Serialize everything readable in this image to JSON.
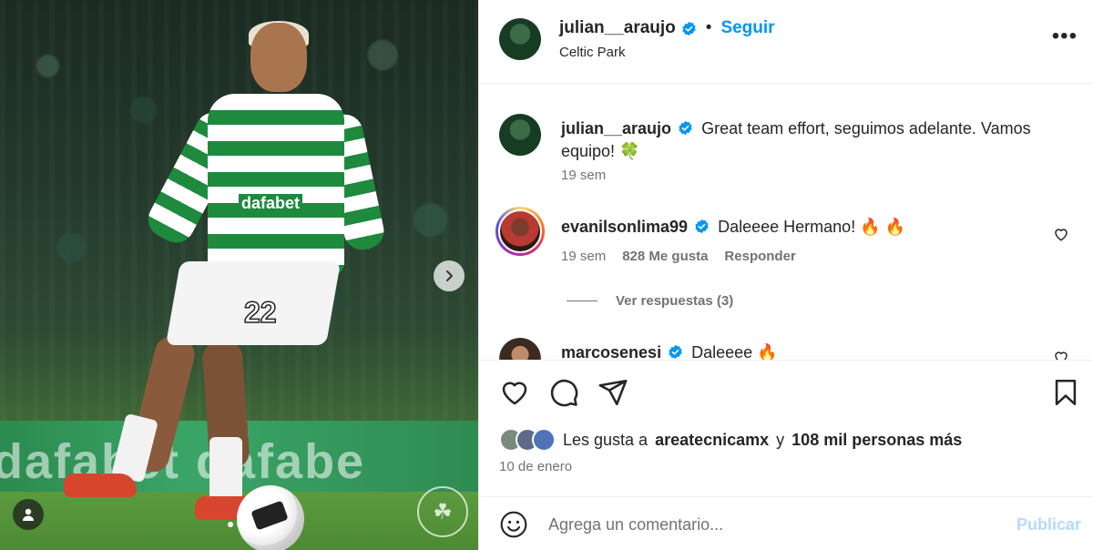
{
  "post": {
    "username": "julian__araujo",
    "follow_label": "Seguir",
    "bullet": "•",
    "location": "Celtic Park",
    "more": "•••"
  },
  "caption": {
    "username": "julian__araujo",
    "text": "Great team effort, seguimos adelante. Vamos equipo! 🍀",
    "time": "19 sem"
  },
  "comments": [
    {
      "username": "evanilsonlima99",
      "text": "Daleeee Hermano! 🔥 🔥",
      "time": "19 sem",
      "likes": "828 Me gusta",
      "reply_label": "Responder",
      "view_replies": "Ver respuestas (3)"
    },
    {
      "username": "marcosenesi",
      "text": "Daleeee 🔥"
    }
  ],
  "likes": {
    "prefix": "Les gusta a",
    "user": "areatecnicamx",
    "connector": "y",
    "others": "108 mil personas más"
  },
  "date": "10 de enero",
  "composer": {
    "placeholder": "Agrega un comentario...",
    "publish_label": "Publicar"
  },
  "photo": {
    "sponsor": "dafabet",
    "shirt_number": "22",
    "adboard": "dafabet dafabe"
  },
  "colors": {
    "follow_blue": "#0095f6",
    "verified_blue": "#0095f6",
    "celtic_green": "#1e8a3e",
    "publish_disabled": "#b3dbff"
  },
  "icons": [
    "chevron-right-icon",
    "user-tag-icon",
    "celtic-crest-icon",
    "verified-badge-icon",
    "more-icon",
    "heart-icon",
    "comment-icon",
    "share-icon",
    "bookmark-icon",
    "emoji-icon"
  ]
}
